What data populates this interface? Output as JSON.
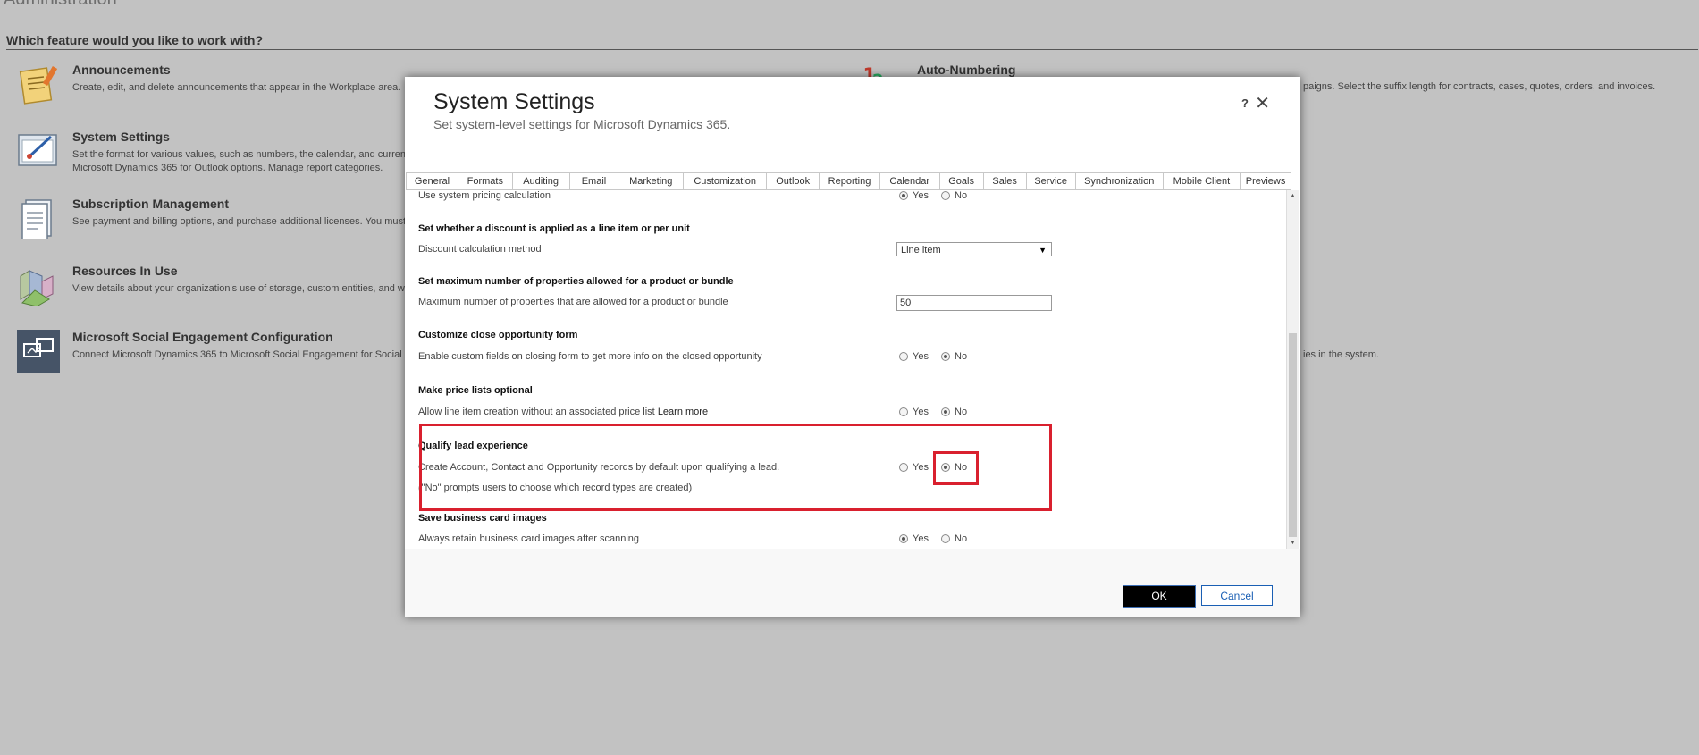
{
  "page": {
    "title": "Administration",
    "question": "Which feature would you like to work with?"
  },
  "features": [
    {
      "title": "Announcements",
      "desc_lines": [
        "Create, edit, and delete announcements that appear in the Workplace area."
      ]
    },
    {
      "title": "System Settings",
      "desc_lines": [
        "Set the format for various values, such as numbers, the calendar, and curren",
        "Microsoft Dynamics 365 for Outlook options. Manage report categories."
      ]
    },
    {
      "title": "Subscription Management",
      "desc_lines": [
        "See payment and billing options, and purchase additional licenses. You must"
      ]
    },
    {
      "title": "Resources In Use",
      "desc_lines": [
        "View details about your organization's use of storage, custom entities, and w"
      ]
    },
    {
      "title": "Microsoft Social Engagement Configuration",
      "desc_lines": [
        "Connect Microsoft Dynamics 365 to Microsoft Social Engagement for Social I"
      ]
    },
    {
      "title": "Auto-Numbering",
      "desc_lines": []
    }
  ],
  "right_overflow": {
    "auto_numbering_desc": "paigns. Select the suffix length for contracts, cases, quotes, orders, and invoices.",
    "social_desc": "ies in the system."
  },
  "dialog": {
    "title": "System Settings",
    "subtitle": "Set system-level settings for Microsoft Dynamics 365.",
    "help": "?",
    "close": "✕",
    "tabs": [
      "General",
      "Formats",
      "Auditing",
      "Email",
      "Marketing",
      "Customization",
      "Outlook",
      "Reporting",
      "Calendar",
      "Goals",
      "Sales",
      "Service",
      "Synchronization",
      "Mobile Client",
      "Previews"
    ],
    "rows": {
      "pricing_calc": {
        "label": "Use system pricing calculation",
        "yes": "Yes",
        "no": "No",
        "selected": "Yes"
      },
      "discount": {
        "heading": "Set whether a discount is applied as a line item or per unit",
        "label": "Discount calculation method",
        "value": "Line item"
      },
      "max_props": {
        "heading": "Set maximum number of properties allowed for a product or bundle",
        "label": "Maximum number of properties that are allowed for a product or bundle",
        "value": "50"
      },
      "close_opp": {
        "heading": "Customize close opportunity form",
        "label": "Enable custom fields on closing form to get more info on the closed opportunity",
        "yes": "Yes",
        "no": "No",
        "selected": "No"
      },
      "price_lists": {
        "heading": "Make price lists optional",
        "label": "Allow line item creation without an associated price list",
        "link": "Learn more",
        "yes": "Yes",
        "no": "No",
        "selected": "No"
      },
      "qualify_lead": {
        "heading": "Qualify lead experience",
        "label": "Create Account, Contact and Opportunity records by default upon qualifying a lead.",
        "note": "(\"No\" prompts users to choose which record types are created)",
        "yes": "Yes",
        "no": "No",
        "selected": "No"
      },
      "business_card": {
        "heading": "Save business card images",
        "label": "Always retain business card images after scanning",
        "yes": "Yes",
        "no": "No",
        "selected": "Yes"
      }
    },
    "ok_label": "OK",
    "cancel_label": "Cancel"
  },
  "colors": {
    "overlay": "#c2c2c2",
    "highlight": "#d9202e",
    "ok_bg": "#000000",
    "cancel_text": "#1a5fb4"
  }
}
